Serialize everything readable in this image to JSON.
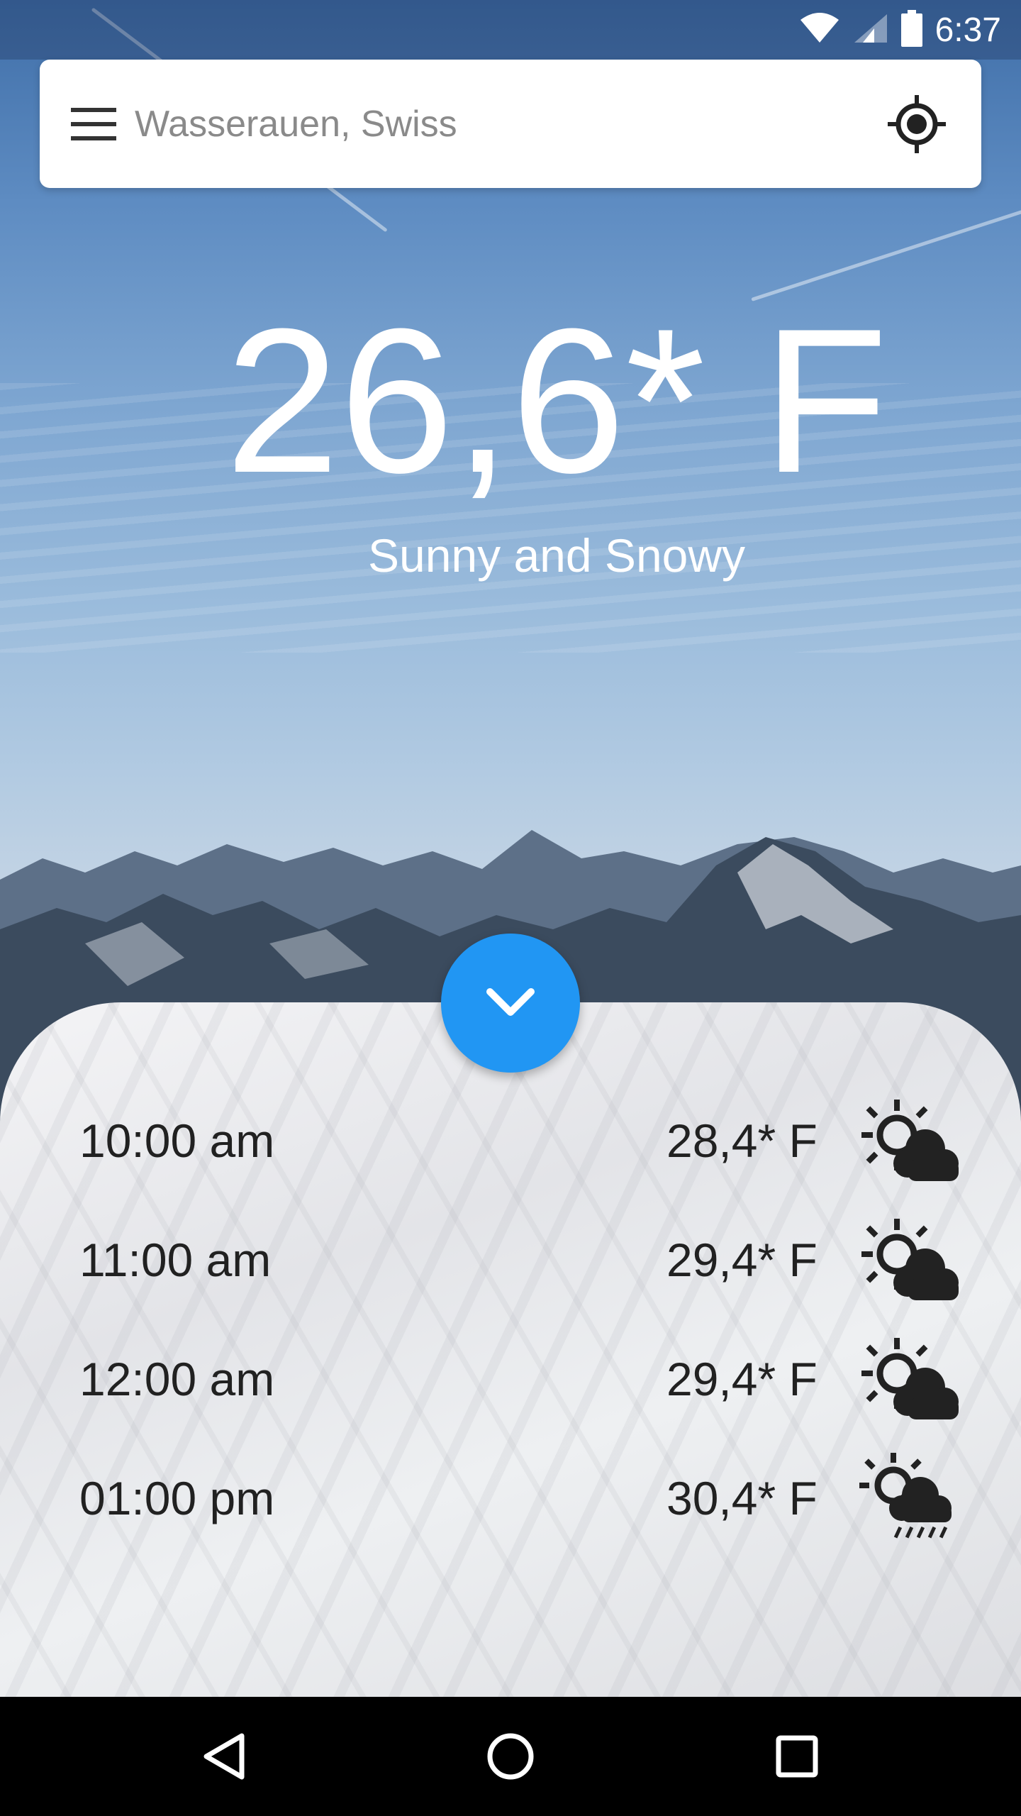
{
  "status_bar": {
    "time": "6:37"
  },
  "search": {
    "placeholder": "Wasserauen, Swiss"
  },
  "current": {
    "temperature": "26,6* F",
    "condition": "Sunny and Snowy"
  },
  "forecast": [
    {
      "time": "10:00 am",
      "temp": "28,4* F",
      "icon": "partly-cloudy-icon"
    },
    {
      "time": "11:00 am",
      "temp": "29,4* F",
      "icon": "partly-cloudy-icon"
    },
    {
      "time": "12:00 am",
      "temp": "29,4* F",
      "icon": "partly-cloudy-icon"
    },
    {
      "time": "01:00 pm",
      "temp": "30,4* F",
      "icon": "sun-rain-icon"
    }
  ],
  "colors": {
    "accent": "#2196f3",
    "text": "#212121"
  }
}
